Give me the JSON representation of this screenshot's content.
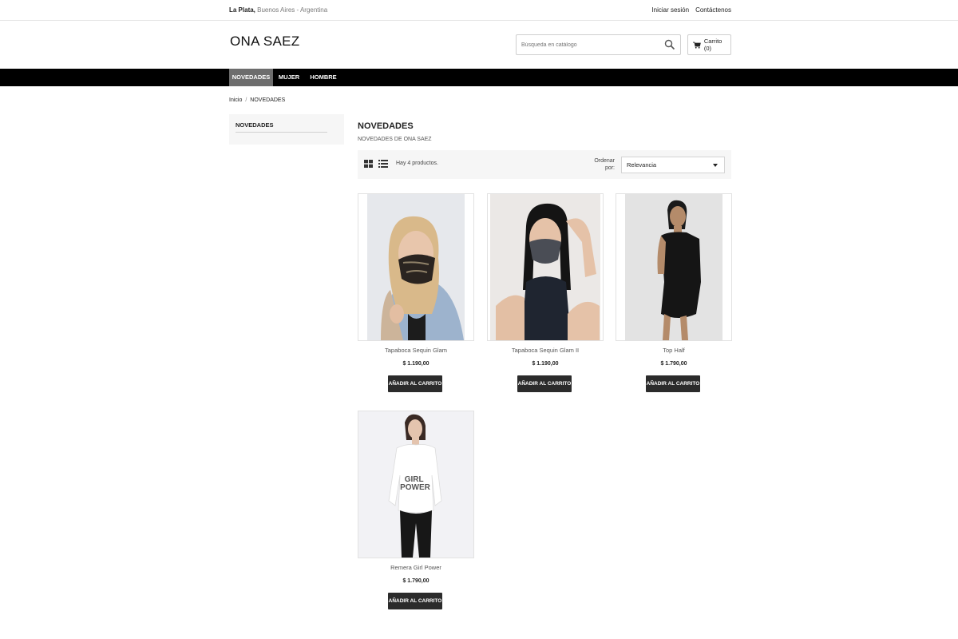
{
  "topbar": {
    "location_bold": "La Plata,",
    "location_rest": "Buenos Aires - Argentina",
    "login": "Iniciar sesión",
    "contact": "Contáctenos"
  },
  "header": {
    "logo": "ONA SAEZ",
    "search_placeholder": "Búsqueda en catálogo",
    "cart_label": "Carrito (0)"
  },
  "nav": {
    "items": [
      {
        "label": "NOVEDADES",
        "active": true
      },
      {
        "label": "MUJER",
        "active": false
      },
      {
        "label": "HOMBRE",
        "active": false
      }
    ]
  },
  "breadcrumb": {
    "home": "Inicio",
    "separator": "/",
    "current": "NOVEDADES"
  },
  "sidebar": {
    "title": "NOVEDADES"
  },
  "category": {
    "title": "NOVEDADES",
    "description": "NOVEDADES DE ONA SAEZ"
  },
  "toolbar": {
    "count_text": "Hay 4 productos.",
    "sort_label_line1": "Ordenar",
    "sort_label_line2": "por:",
    "sort_value": "Relevancia"
  },
  "products": [
    {
      "name": "Tapaboca Sequin Glam",
      "price": "$ 1.190,00",
      "button": "AÑADIR AL CARRITO",
      "image": "woman-blonde-sequin-mask-photo"
    },
    {
      "name": "Tapaboca Sequin Glam II",
      "price": "$ 1.190,00",
      "button": "AÑADIR AL CARRITO",
      "image": "woman-dark-hair-glitter-mask-photo"
    },
    {
      "name": "Top Half",
      "price": "$ 1.790,00",
      "button": "AÑADIR AL CARRITO",
      "image": "woman-black-one-shoulder-dress-photo"
    },
    {
      "name": "Remera Girl Power",
      "price": "$ 1.790,00",
      "button": "AÑADIR AL CARRITO",
      "image": "woman-white-girl-power-tee-photo",
      "print_text": "GIRL POWER"
    }
  ],
  "colors": {
    "nav_bg": "#000000",
    "nav_active": "#6d6d6d",
    "button_bg": "#2b2b2b",
    "panel_bg": "#f6f6f6"
  }
}
